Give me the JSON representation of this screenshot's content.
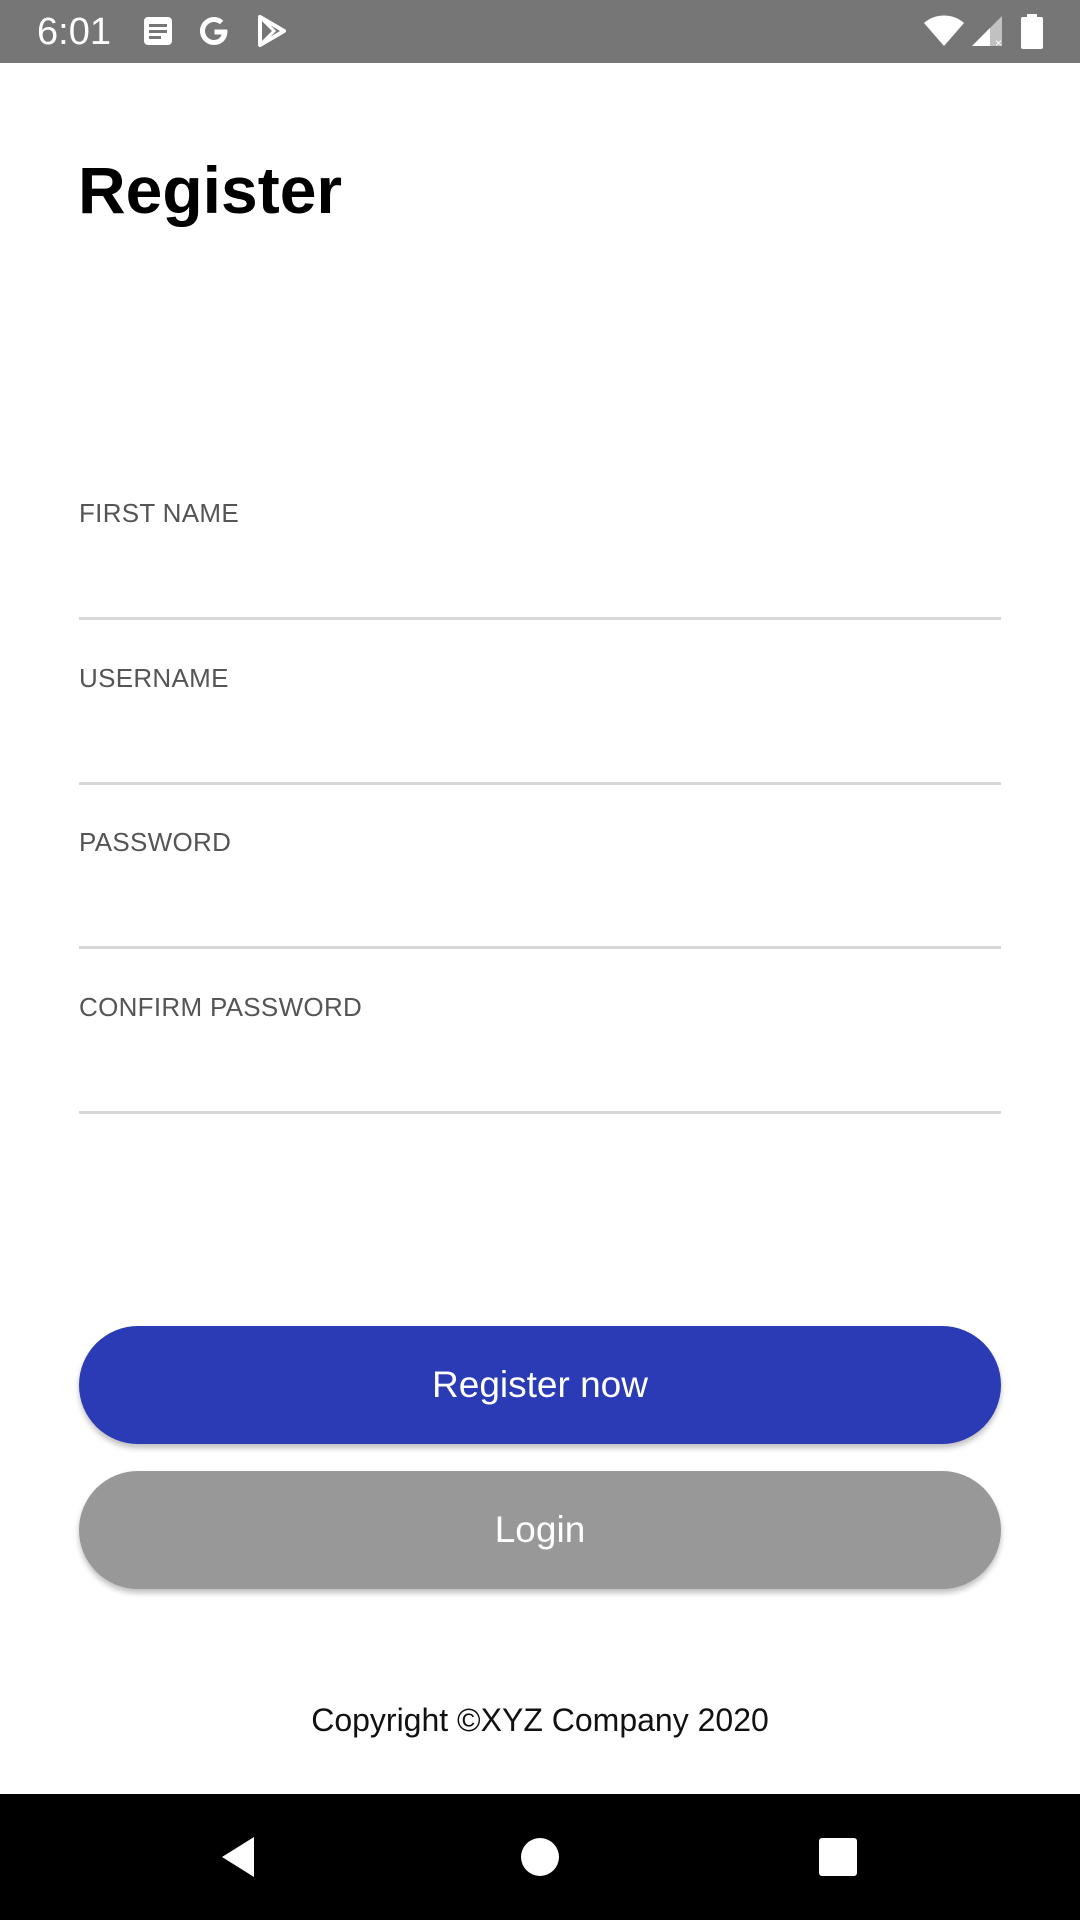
{
  "status_bar": {
    "time": "6:01",
    "background": "#767676",
    "icons": [
      "notes-icon",
      "google-icon",
      "play-store-icon",
      "wifi-icon",
      "signal-icon",
      "battery-icon"
    ]
  },
  "page": {
    "title": "Register"
  },
  "form": {
    "fields": [
      {
        "label": "FIRST NAME",
        "value": "",
        "placeholder": ""
      },
      {
        "label": "USERNAME",
        "value": "",
        "placeholder": ""
      },
      {
        "label": "PASSWORD",
        "value": "",
        "placeholder": ""
      },
      {
        "label": "CONFIRM PASSWORD",
        "value": "",
        "placeholder": ""
      }
    ]
  },
  "buttons": {
    "register_label": "Register now",
    "register_color": "#2a3bb5",
    "login_label": "Login",
    "login_color": "#989898"
  },
  "footer": {
    "copyright": "Copyright ©XYZ Company 2020"
  },
  "nav_bar": {
    "icons": [
      "back-icon",
      "home-icon",
      "recents-icon"
    ]
  }
}
